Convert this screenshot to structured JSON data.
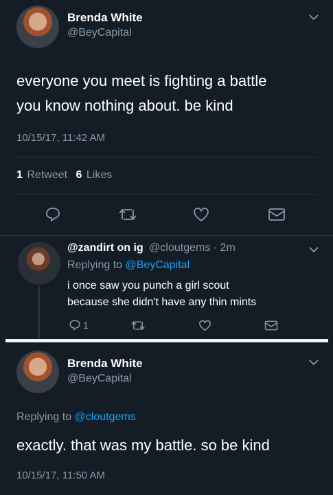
{
  "tweet1": {
    "name": "Brenda White",
    "handle": "@BeyCapital",
    "text_line1": "everyone you meet is fighting a battle",
    "text_line2": "you know nothing about. be kind",
    "timestamp": "10/15/17, 11:42 AM",
    "retweet_count": "1",
    "retweet_label": "Retweet",
    "like_count": "6",
    "like_label": "Likes"
  },
  "reply": {
    "name": "@zandirt on ig",
    "handle": "@cloutgems",
    "time": "· 2m",
    "replying_prefix": "Replying to",
    "replying_to": "@BeyCapital",
    "text_line1": "i once saw you punch a girl scout",
    "text_line2": "because she didn't have any thin mints",
    "reply_count": "1"
  },
  "tweet2": {
    "name": "Brenda White",
    "handle": "@BeyCapital",
    "replying_prefix": "Replying to",
    "replying_to": "@cloutgems",
    "text": "exactly. that was my battle. so be kind",
    "timestamp": "10/15/17, 11:50 AM"
  },
  "icons": [
    "reply-icon",
    "retweet-icon",
    "like-icon",
    "message-icon",
    "chevron-down-icon"
  ],
  "colors": {
    "background": "#141d26",
    "muted": "#8899a6",
    "link": "#1da1f2",
    "divider": "#2b3743"
  }
}
